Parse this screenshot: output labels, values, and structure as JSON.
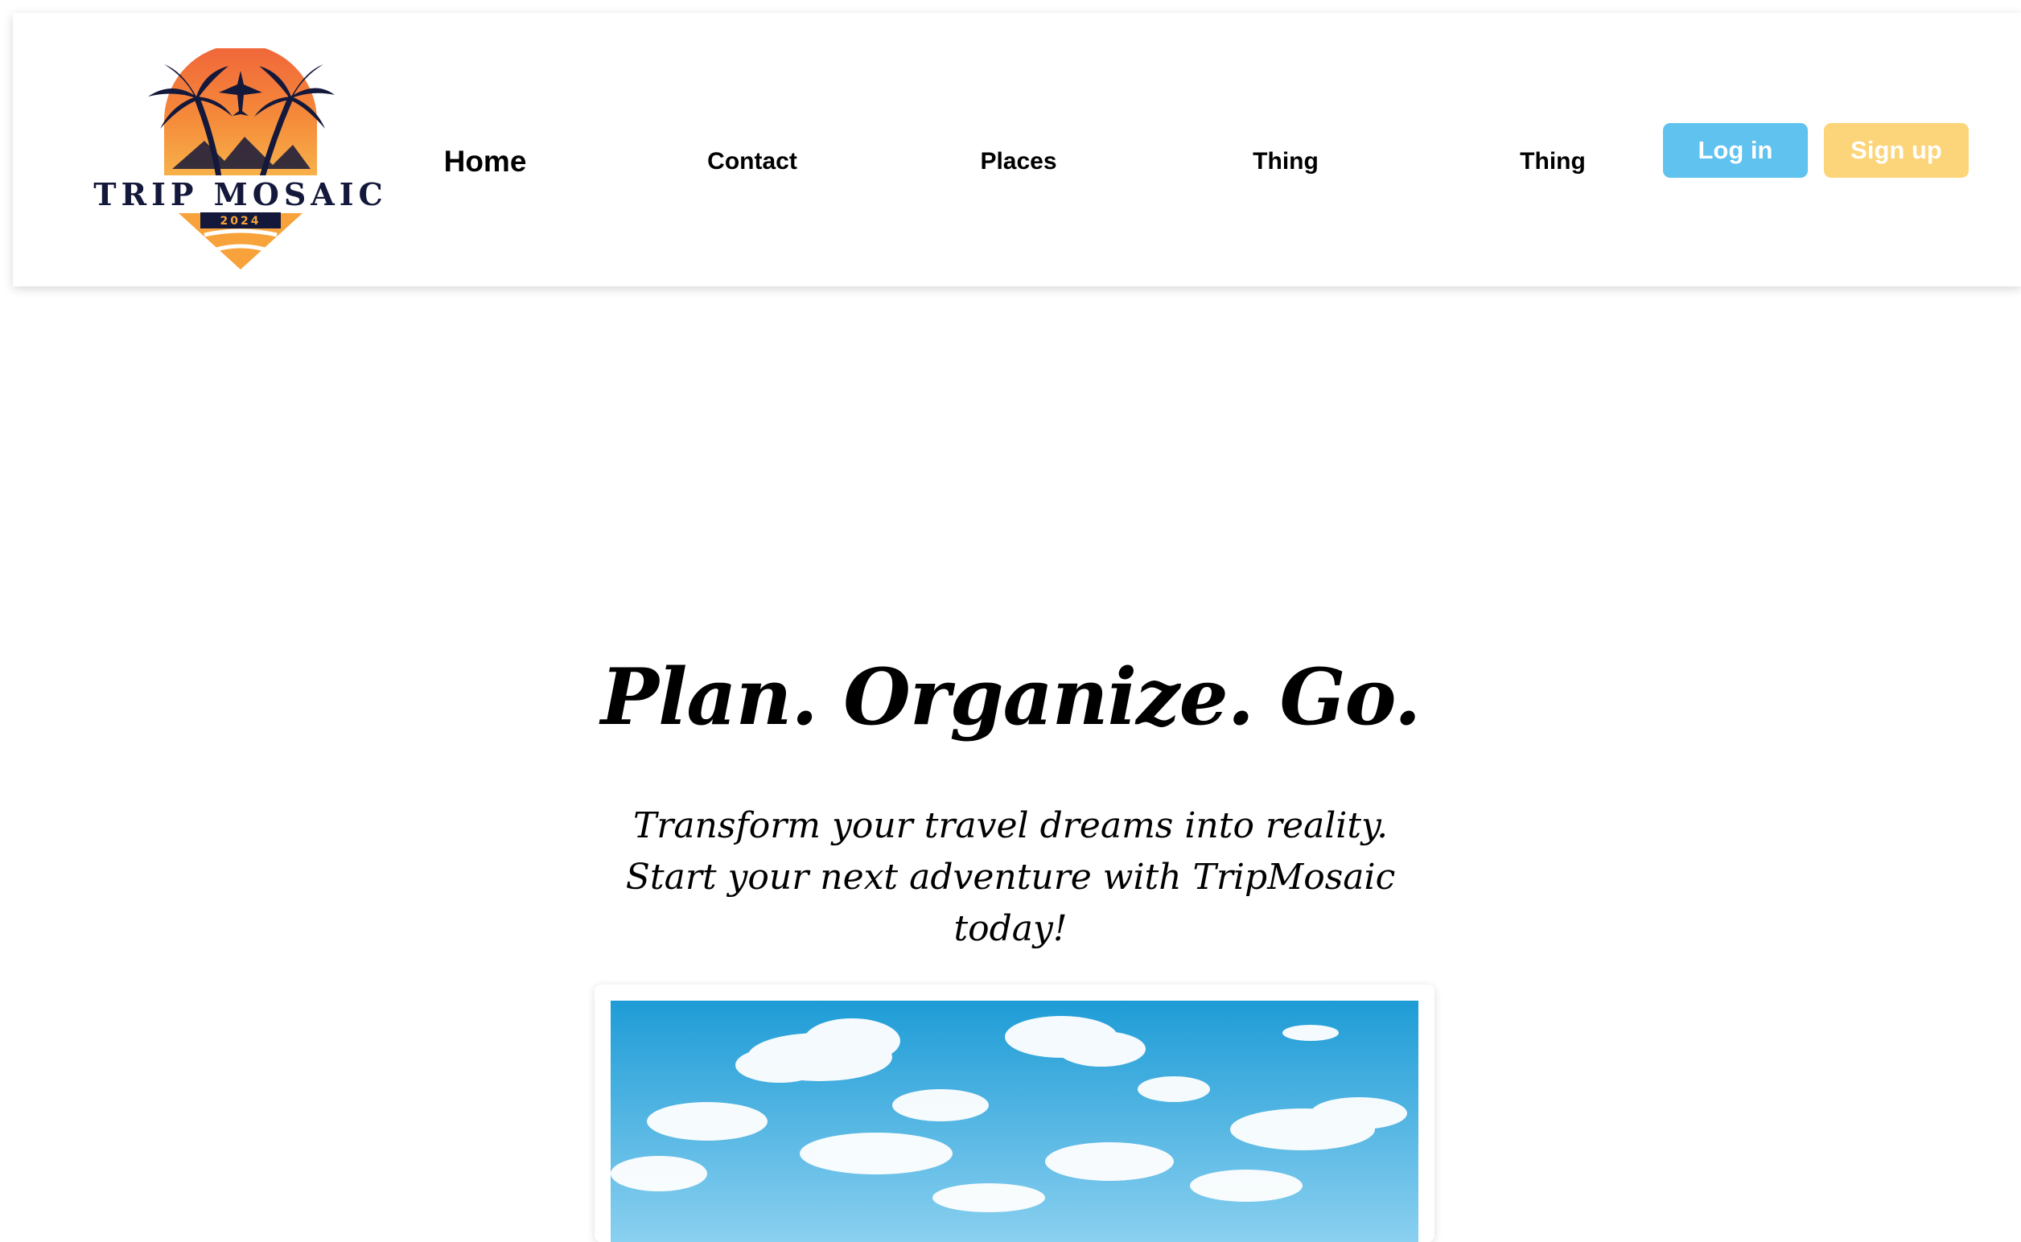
{
  "brand": {
    "name": "TRIP MOSAIC",
    "year": "2024"
  },
  "nav": {
    "links": [
      "Home",
      "Contact",
      "Places",
      "Thing",
      "Thing"
    ],
    "active": "Home"
  },
  "auth": {
    "login_label": "Log in",
    "signup_label": "Sign up"
  },
  "hero": {
    "title": "Plan. Organize. Go.",
    "subtitle": "Transform your travel dreams into reality. Start your next adventure with TripMosaic today!"
  },
  "colors": {
    "login_button": "#5fc2ef",
    "signup_button": "#fcd57a",
    "logo_navy": "#14183a",
    "logo_orange": "#f7a23a",
    "logo_sunset": "#f0653a",
    "sky_top": "#1e9cd6",
    "sky_bottom": "#8ad0f0"
  },
  "icons": {
    "logo": "palm-trees-plane-sunset-logo",
    "hero_image": "sky-clouds-photo"
  }
}
